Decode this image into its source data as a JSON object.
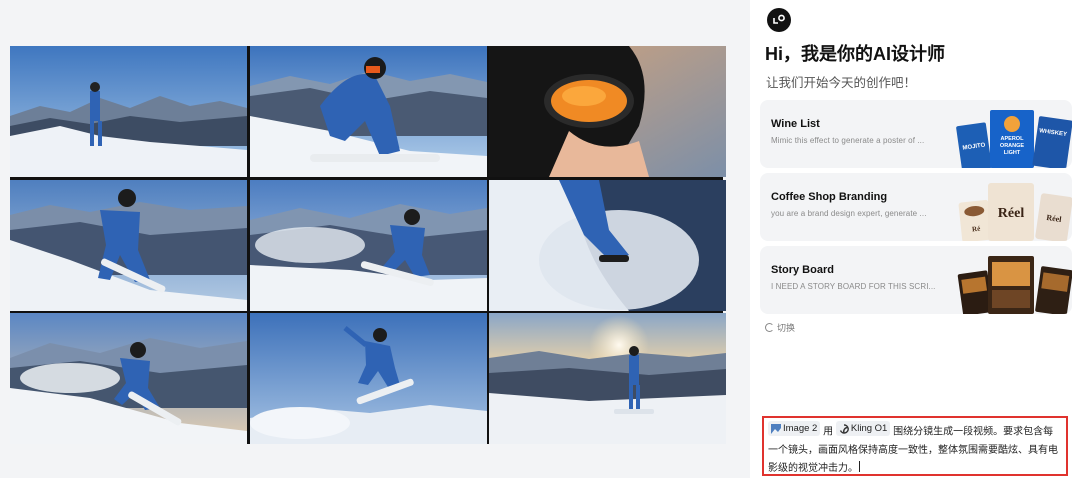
{
  "canvas": {
    "images": [
      {
        "name": "snowboarder-standing-ridge"
      },
      {
        "name": "snowboarder-crouching-binding"
      },
      {
        "name": "snowboarder-goggles-closeup"
      },
      {
        "name": "snowboarder-carving-slope"
      },
      {
        "name": "snowboarder-riding-mountains"
      },
      {
        "name": "snowboarder-powder-spray"
      },
      {
        "name": "snowboarder-sunset-carve"
      },
      {
        "name": "snowboarder-jump-air"
      },
      {
        "name": "snowboarder-sunrise-standing"
      }
    ]
  },
  "panel": {
    "greeting": "Hi，我是你的AI设计师",
    "subtitle": "让我们开始今天的创作吧！",
    "cards": [
      {
        "title": "Wine List",
        "description": "Mimic this effect to generate a poster of ...",
        "art_text": [
          "MOJITO",
          "APEROL ORANGE LIGHT",
          "WHISKEY"
        ]
      },
      {
        "title": "Coffee Shop Branding",
        "description": "you are a brand design expert, generate ...",
        "art_text": [
          "Ré",
          "Réel",
          "Réel"
        ]
      },
      {
        "title": "Story Board",
        "description": "I NEED A STORY BOARD FOR THIS SCRI...",
        "art_text": []
      }
    ],
    "switch_label": "切换",
    "prompt": {
      "chip_image": "Image 2",
      "word_use": "用",
      "chip_model": "Kling O1",
      "text": "围绕分镜生成一段视频。要求包含每一个镜头，画面风格保持高度一致性，整体氛围需要酷炫、具有电影级的视觉冲击力。"
    }
  },
  "colors": {
    "highlight_border": "#e0332e",
    "sky_blue": "#4f86c6",
    "snow": "#f4f6f9",
    "jacket_blue": "#2f63b4"
  }
}
